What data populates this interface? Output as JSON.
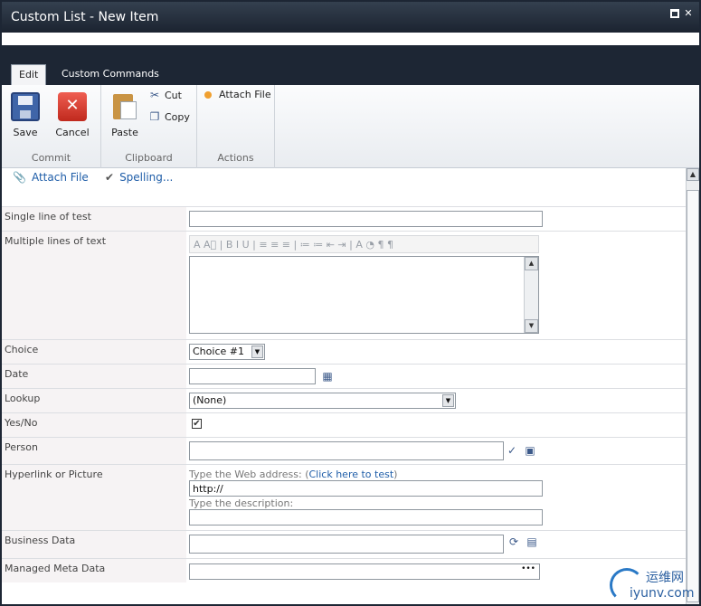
{
  "window": {
    "title": "Custom List - New Item"
  },
  "tabs": [
    {
      "label": "Edit",
      "active": true
    },
    {
      "label": "Custom Commands",
      "active": false
    }
  ],
  "ribbon": {
    "commit": {
      "label": "Commit",
      "save": "Save",
      "cancel": "Cancel"
    },
    "clipboard": {
      "label": "Clipboard",
      "paste": "Paste",
      "cut": "Cut",
      "copy": "Copy"
    },
    "actions": {
      "label": "Actions",
      "attach": "Attach File"
    }
  },
  "toolbar": {
    "attach": "Attach File",
    "spelling": "Spelling..."
  },
  "fields": {
    "single": {
      "label": "Single line of test",
      "value": ""
    },
    "multi": {
      "label": "Multiple lines of text",
      "toolbar_glyphs": "A  A⃝ | B  I  U | ≡ ≡ ≡ | ≔ ≔ ⇤ ⇥ | A  ◔  ¶ ¶"
    },
    "choice": {
      "label": "Choice",
      "value": "Choice #1"
    },
    "date": {
      "label": "Date",
      "value": ""
    },
    "lookup": {
      "label": "Lookup",
      "value": "(None)"
    },
    "yesno": {
      "label": "Yes/No",
      "checked": true,
      "mark": "✔"
    },
    "person": {
      "label": "Person",
      "value": ""
    },
    "hyperlink": {
      "label": "Hyperlink or Picture",
      "addr_hint": "Type the Web address: (",
      "test_link": "Click here to test",
      "addr_hint_end": ")",
      "url": "http://",
      "desc_hint": "Type the description:",
      "desc": ""
    },
    "business": {
      "label": "Business Data",
      "value": ""
    },
    "managed": {
      "label": "Managed Meta Data",
      "value": "",
      "ellipsis": "•••"
    }
  },
  "watermark": {
    "cn": "运维网",
    "en": "iyunv.com"
  },
  "colors": {
    "link": "#1e5da8",
    "titlebar": "#1b2330",
    "label_bg": "#f6f3f4"
  }
}
